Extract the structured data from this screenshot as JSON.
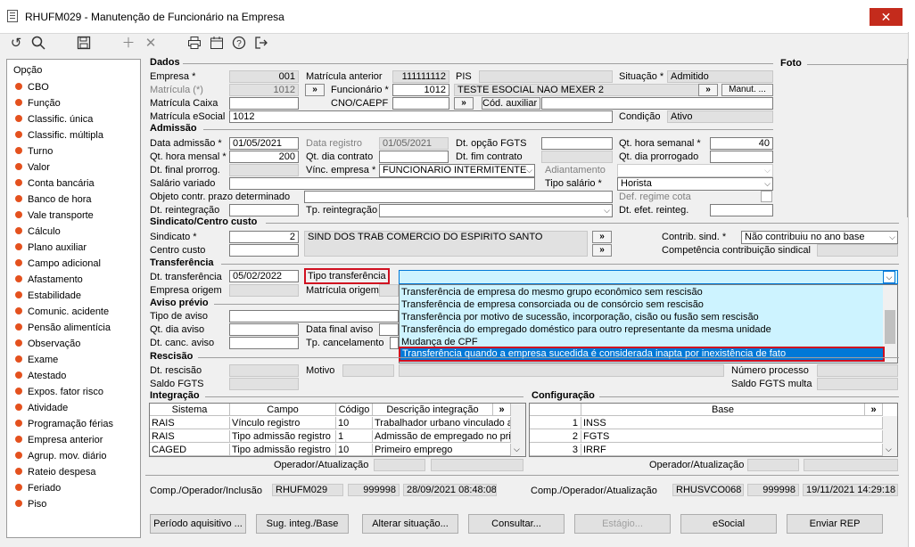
{
  "window": {
    "title": "RHUFM029 - Manutenção de Funcionário na Empresa",
    "close_glyph": "✕"
  },
  "toolbar": {
    "icons": [
      "undo-icon",
      "search-icon",
      "save-icon",
      "add-icon",
      "delete-icon",
      "print-icon",
      "calendar-icon",
      "help-icon",
      "exit-icon"
    ]
  },
  "sidebar": {
    "header": "Opção",
    "items": [
      "CBO",
      "Função",
      "Classific. única",
      "Classific. múltipla",
      "Turno",
      "Valor",
      "Conta bancária",
      "Banco de hora",
      "Vale transporte",
      "Cálculo",
      "Plano auxiliar",
      "Campo adicional",
      "Afastamento",
      "Estabilidade",
      "Comunic. acidente",
      "Pensão alimentícia",
      "Observação",
      "Exame",
      "Atestado",
      "Expos. fator risco",
      "Atividade",
      "Programação férias",
      "Empresa anterior",
      "Agrup. mov. diário",
      "Rateio despesa",
      "Feriado",
      "Piso"
    ]
  },
  "dados": {
    "section": "Dados",
    "empresa_label": "Empresa *",
    "empresa": "001",
    "matricula_label": "Matrícula (*)",
    "matricula": "1012",
    "matricula_caixa_label": "Matrícula Caixa",
    "matricula_esocial_label": "Matrícula eSocial",
    "matricula_esocial": "1012",
    "mat_anterior_label": "Matrícula anterior",
    "mat_anterior": "111111112",
    "funcionario_label": "Funcionário *",
    "funcionario": "1012",
    "cno_label": "CNO/CAEPF",
    "pis_label": "PIS",
    "nome": "TESTE ESOCIAL NAO MEXER 2",
    "cod_auxiliar_label": "Cód. auxiliar",
    "situacao_label": "Situação *",
    "situacao": "Admitido",
    "manut_label": "Manut. ...",
    "condicao_label": "Condição",
    "condicao": "Ativo",
    "foto_label": "Foto",
    "arrow_btn": "»"
  },
  "admissao": {
    "section": "Admissão",
    "data_adm_label": "Data admissão *",
    "data_adm": "01/05/2021",
    "qt_hora_mensal_label": "Qt. hora mensal *",
    "qt_hora_mensal": "200",
    "dt_final_prorrog_label": "Dt. final prorrog.",
    "salario_variado_label": "Salário variado",
    "objeto_label": "Objeto contr. prazo determinado",
    "dt_reintegracao_label": "Dt. reintegração",
    "data_registro_label": "Data registro",
    "data_registro": "01/05/2021",
    "qt_dia_contrato_label": "Qt. dia contrato",
    "vinc_empresa_label": "Vínc. empresa *",
    "vinc_empresa": "FUNCIONARIO INTERMITENTE",
    "tp_reintegracao_label": "Tp. reintegração",
    "dt_opcao_fgts_label": "Dt. opção FGTS",
    "dt_fim_contrato_label": "Dt. fim contrato",
    "adiantamento_label": "Adiantamento",
    "tipo_salario_label": "Tipo salário *",
    "qt_hora_semanal_label": "Qt. hora semanal *",
    "qt_hora_semanal": "40",
    "qt_dia_prorrogado_label": "Qt. dia prorrogado",
    "tipo_salario": "Horista",
    "def_regime_cota_label": "Def. regime cota",
    "dt_efet_reinteg_label": "Dt. efet. reinteg."
  },
  "sindicato": {
    "section": "Sindicato/Centro custo",
    "sindicato_label": "Sindicato *",
    "sindicato": "2",
    "sindicato_nome": "SIND DOS TRAB COMERCIO DO ESPIRITO SANTO",
    "centro_custo_label": "Centro custo",
    "contrib_label": "Contrib. sind. *",
    "contrib": "Não contribuiu no ano base",
    "competencia_label": "Competência contribuição sindical"
  },
  "transferencia": {
    "section": "Transferência",
    "dt_transf_label": "Dt. transferência",
    "dt_transf": "05/02/2022",
    "tipo_transf_label": "Tipo transferência",
    "empresa_origem_label": "Empresa origem",
    "matricula_origem_label": "Matrícula origem",
    "options": [
      "Transferência de empresa do mesmo grupo econômico sem rescisão",
      "Transferência de empresa consorciada ou de consórcio sem rescisão",
      "Transferência por motivo de sucessão, incorporação, cisão ou fusão sem rescisão",
      "Transferência do empregado doméstico para outro representante da mesma unidade",
      "Mudança de CPF",
      "Transferência quando a empresa sucedida é considerada inapta por inexistência de fato"
    ]
  },
  "aviso": {
    "section": "Aviso prévio",
    "tipo_label": "Tipo de aviso",
    "qt_dia_label": "Qt. dia aviso",
    "dt_canc_label": "Dt. canc. aviso",
    "data_final_label": "Data final aviso",
    "tp_cancelamento_label": "Tp. cancelamento"
  },
  "rescisao": {
    "section": "Rescisão",
    "dt_rescisao_label": "Dt. rescisão",
    "saldo_fgts_label": "Saldo FGTS",
    "motivo_label": "Motivo",
    "numero_processo_label": "Número processo",
    "saldo_fgts_multa_label": "Saldo FGTS multa"
  },
  "integracao": {
    "section": "Integração",
    "columns": [
      "Sistema",
      "Campo",
      "Código",
      "Descrição integração"
    ],
    "rows": [
      [
        "RAIS",
        "Vínculo registro",
        "10",
        "Trabalhador urbano vinculado a"
      ],
      [
        "RAIS",
        "Tipo admissão registro",
        "1",
        "Admissão de empregado no pri"
      ],
      [
        "CAGED",
        "Tipo admissão registro",
        "10",
        "Primeiro emprego"
      ]
    ],
    "operador_label": "Operador/Atualização"
  },
  "configuracao": {
    "section": "Configuração",
    "column": "Base",
    "rows": [
      [
        "1",
        "INSS"
      ],
      [
        "2",
        "FGTS"
      ],
      [
        "3",
        "IRRF"
      ]
    ],
    "operador_label": "Operador/Atualização"
  },
  "footer": {
    "inclusao_label": "Comp./Operador/Inclusão",
    "inclusao_comp": "RHUFM029",
    "inclusao_op": "999998",
    "inclusao_dt": "28/09/2021 08:48:08",
    "atualizacao_label": "Comp./Operador/Atualização",
    "atual_comp": "RHUSVCO068",
    "atual_op": "999998",
    "atual_dt": "19/11/2021 14:29:18"
  },
  "buttons": {
    "periodo": "Período aquisitivo ...",
    "sug_integ": "Sug. integ./Base",
    "alterar": "Alterar situação...",
    "consultar": "Consultar...",
    "estagio": "Estágio...",
    "esocial": "eSocial",
    "enviar": "Enviar REP"
  }
}
